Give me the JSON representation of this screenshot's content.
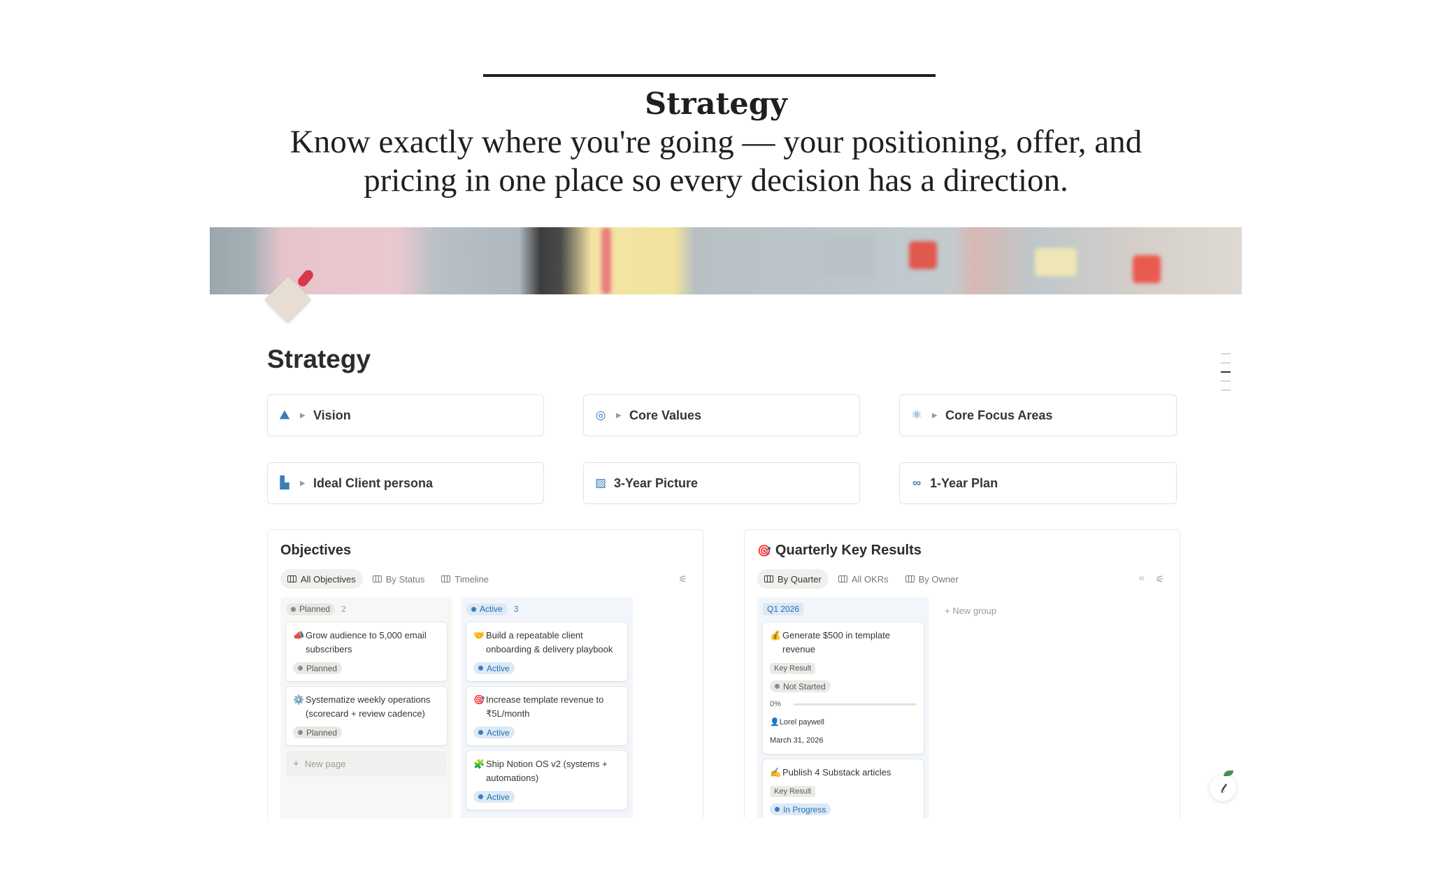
{
  "hero": {
    "title": "Strategy",
    "subtitle_line1": "Know exactly where you're going — your positioning, offer, and",
    "subtitle_line2": "pricing in one place so every decision has a direction."
  },
  "page": {
    "title": "Strategy"
  },
  "cards": [
    {
      "icon": "person-on-mountain-icon",
      "label": "Vision",
      "toggle": true
    },
    {
      "icon": "target-icon",
      "label": "Core Values",
      "toggle": true
    },
    {
      "icon": "atom-icon",
      "label": "Core Focus Areas",
      "toggle": true
    },
    {
      "icon": "factory-icon",
      "label": "Ideal Client persona",
      "toggle": true
    },
    {
      "icon": "chart-icon",
      "label": "3-Year Picture",
      "toggle": false
    },
    {
      "icon": "infinity-icon",
      "label": "1-Year Plan",
      "toggle": false
    }
  ],
  "objectives": {
    "title": "Objectives",
    "tabs": [
      "All Objectives",
      "By Status",
      "Timeline"
    ],
    "groups": [
      {
        "label": "Planned",
        "count": "2",
        "items": [
          {
            "emoji": "📣",
            "title": "Grow audience to 5,000 email subscribers",
            "status": "Planned"
          },
          {
            "emoji": "⚙️",
            "title": "Systematize weekly operations (scorecard + review cadence)",
            "status": "Planned"
          }
        ],
        "new_page": "New page"
      },
      {
        "label": "Active",
        "count": "3",
        "items": [
          {
            "emoji": "🤝",
            "title": "Build a repeatable client onboarding & delivery playbook",
            "status": "Active"
          },
          {
            "emoji": "🎯",
            "title": "Increase template revenue to ₹5L/month",
            "status": "Active"
          },
          {
            "emoji": "🧩",
            "title": "Ship Notion OS v2 (systems + automations)",
            "status": "Active"
          }
        ]
      }
    ]
  },
  "okrs": {
    "emoji": "🎯",
    "title": "Quarterly Key Results",
    "tabs": [
      "By Quarter",
      "All OKRs",
      "By Owner"
    ],
    "group_label": "Q1 2026",
    "new_group": "New group",
    "items": [
      {
        "emoji": "💰",
        "title": "Generate $500 in template revenue",
        "tag": "Key Result",
        "status": "Not Started",
        "progress_label": "0%",
        "progress": 0,
        "owner": "Lorel paywell",
        "date": "March 31, 2026"
      },
      {
        "emoji": "✍️",
        "title": "Publish 4 Substack articles",
        "tag": "Key Result",
        "status": "In Progress"
      }
    ]
  },
  "colors": {
    "accent_blue": "#2f81c8",
    "text": "#37352f"
  }
}
